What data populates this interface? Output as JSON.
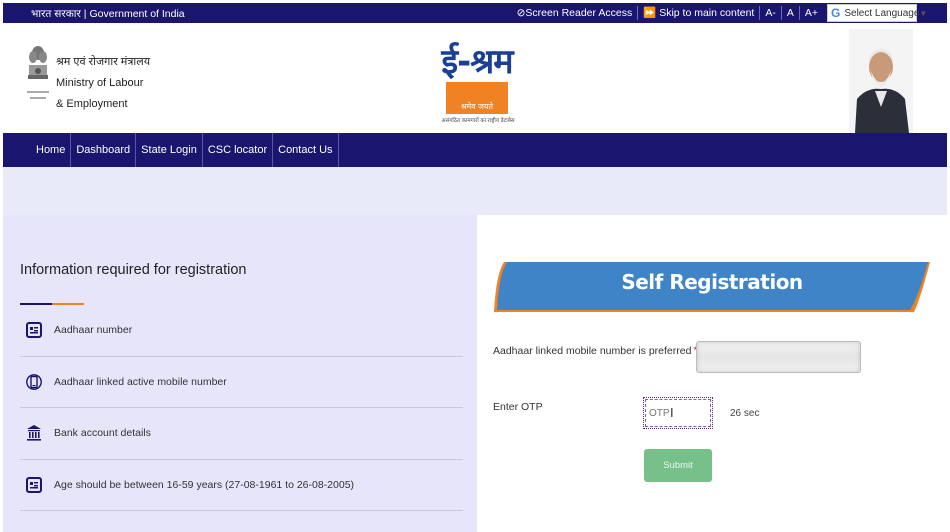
{
  "topbar": {
    "gov_hindi": "भारत सरकार",
    "gov_english": "Government of India",
    "screen_reader": "Screen Reader Access",
    "skip_main": "Skip to main content",
    "font_small": "A-",
    "font_normal": "A",
    "font_large": "A+",
    "language": "Select Language",
    "language_arrow": "▼"
  },
  "header": {
    "ministry_hindi": "श्रम एवं रोजगार मंत्रालय",
    "ministry_line1": "Ministry of Labour",
    "ministry_line2": "& Employment",
    "logo_title": "ई-श्रम",
    "logo_subtitle": "श्रमेव जयते",
    "logo_tagline": "असंगठित कामगारों का राष्ट्रीय डेटाबेस"
  },
  "nav": {
    "items": [
      "Home",
      "Dashboard",
      "State Login",
      "CSC locator",
      "Contact Us"
    ]
  },
  "info": {
    "title": "Information required for registration",
    "items": [
      {
        "icon": "id-card-icon",
        "text": "Aadhaar number"
      },
      {
        "icon": "mobile-phone-icon",
        "text": "Aadhaar linked active mobile number"
      },
      {
        "icon": "bank-icon",
        "text": "Bank account details"
      },
      {
        "icon": "id-card-icon",
        "text": "Age should be between 16-59 years (27-08-1961 to 26-08-2005)"
      }
    ]
  },
  "registration": {
    "title": "Self Registration",
    "mobile_label": "Aadhaar linked mobile number is preferred",
    "required_mark": "*",
    "mobile_value": "",
    "otp_label": "Enter OTP",
    "otp_placeholder": "OTP",
    "timer": "26 sec",
    "submit_label": "Submit"
  },
  "colors": {
    "navy": "#1a1670",
    "orange": "#f08224",
    "banner_blue": "#3f84c6",
    "submit_green": "#78c08a",
    "panel_lavender": "#e6e5fa"
  }
}
